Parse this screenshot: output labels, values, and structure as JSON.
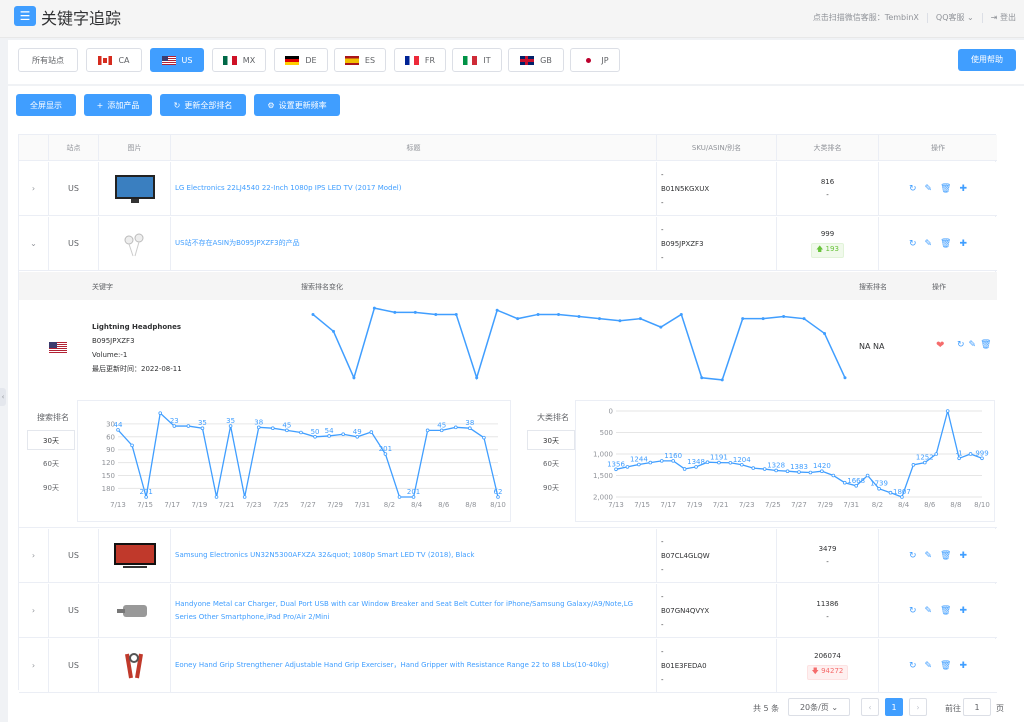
{
  "app": {
    "title": "关键字追踪",
    "scan_service": "点击扫描微信客服：TembinX",
    "qq_service": "QQ客服",
    "logout": "登出"
  },
  "sites": [
    {
      "label": "所有站点",
      "flag": ""
    },
    {
      "label": "CA",
      "flag": "ca"
    },
    {
      "label": "US",
      "flag": "us"
    },
    {
      "label": "MX",
      "flag": "mx"
    },
    {
      "label": "DE",
      "flag": "de"
    },
    {
      "label": "ES",
      "flag": "es"
    },
    {
      "label": "FR",
      "flag": "fr"
    },
    {
      "label": "IT",
      "flag": "it"
    },
    {
      "label": "GB",
      "flag": "gb"
    },
    {
      "label": "JP",
      "flag": "jp"
    }
  ],
  "help_label": "使用帮助",
  "toolbar": {
    "fullscreen": "全屏显示",
    "add_product": "添加产品",
    "update_all": "更新全部排名",
    "set_frequency": "设置更新频率"
  },
  "table": {
    "headers": {
      "site": "站点",
      "image": "图片",
      "title": "标题",
      "sku": "SKU/ASIN/别名",
      "rank": "大类排名",
      "ops": "操作"
    },
    "rows": [
      {
        "site": "US",
        "title": "LG Electronics 22LJ4540 22-Inch 1080p IPS LED TV (2017 Model)",
        "sku_top": "-",
        "asin": "B01N5KGXUX",
        "sku_bottom": "-",
        "rank": "816",
        "change": "-",
        "change_type": "none"
      },
      {
        "site": "US",
        "title": "US站不存在ASIN为B095JPXZF3的产品",
        "sku_top": "-",
        "asin": "B095JPXZF3",
        "sku_bottom": "-",
        "rank": "999",
        "change": "193",
        "change_type": "up"
      },
      {
        "site": "US",
        "title": "Samsung Electronics UN32N5300AFXZA 32&quot; 1080p Smart LED TV (2018), Black",
        "sku_top": "-",
        "asin": "B07CL4GLQW",
        "sku_bottom": "-",
        "rank": "3479",
        "change": "-",
        "change_type": "none"
      },
      {
        "site": "US",
        "title": "Handyone Metal car Charger, Dual Port USB with car Window Breaker and Seat Belt Cutter for iPhone/Samsung Galaxy/A9/Note,LG Series Other Smartphone,iPad Pro/Air 2/Mini",
        "sku_top": "-",
        "asin": "B07GN4QVYX",
        "sku_bottom": "-",
        "rank": "11386",
        "change": "-",
        "change_type": "none"
      },
      {
        "site": "US",
        "title": "Eoney Hand Grip Strengthener Adjustable Hand Grip Exerciser，Hand Gripper with Resistance Range 22 to 88 Lbs(10-40kg)",
        "sku_top": "-",
        "asin": "B01E3FEDA0",
        "sku_bottom": "-",
        "rank": "206074",
        "change": "94272",
        "change_type": "down"
      }
    ]
  },
  "keyword_panel": {
    "headers": {
      "keyword": "关键字",
      "trend": "搜索排名变化",
      "search_rank": "搜索排名",
      "ops": "操作"
    },
    "keyword": "Lightning Headphones",
    "asin": "B095JPXZF3",
    "volume": "Volume:-1",
    "updated": "最后更新时间：2022-08-11",
    "search_rank_value": "NA NA",
    "left_chart_label": "搜索排名",
    "right_chart_label": "大类排名",
    "ranges": [
      "30天",
      "60天",
      "90天"
    ]
  },
  "chart_data": [
    {
      "type": "line",
      "title": "搜索排名变化",
      "values": [
        20,
        60,
        170,
        5,
        15,
        15,
        20,
        20,
        170,
        10,
        30,
        20,
        20,
        25,
        30,
        35,
        30,
        50,
        20,
        170,
        175,
        30,
        30,
        25,
        30,
        65,
        170
      ]
    },
    {
      "type": "line",
      "title": "搜索排名",
      "x": [
        "7/13",
        "7/15",
        "7/17",
        "7/19",
        "7/21",
        "7/23",
        "7/25",
        "7/27",
        "7/29",
        "7/31",
        "8/2",
        "8/4",
        "8/6",
        "8/8",
        "8/10"
      ],
      "y_ticks": [
        "30",
        "60",
        "90",
        "120",
        "150",
        "180"
      ],
      "ylim": [
        0,
        200
      ],
      "values": [
        44,
        80,
        201,
        5,
        35,
        35,
        40,
        201,
        35,
        201,
        38,
        40,
        45,
        50,
        60,
        58,
        54,
        60,
        49,
        100,
        201,
        201,
        45,
        45,
        38,
        40,
        62,
        201
      ],
      "labels": [
        "44",
        "201",
        "23",
        "35",
        "35",
        "38",
        "45",
        "50",
        "54",
        "49",
        "201",
        "201",
        "45",
        "38",
        "62"
      ]
    },
    {
      "type": "line",
      "title": "大类排名",
      "x": [
        "7/13",
        "7/15",
        "7/17",
        "7/19",
        "7/21",
        "7/23",
        "7/25",
        "7/27",
        "7/29",
        "7/31",
        "8/2",
        "8/4",
        "8/6",
        "8/8",
        "8/10"
      ],
      "y_ticks": [
        "0",
        "500",
        "1,000",
        "1,500",
        "2,000"
      ],
      "ylim": [
        0,
        2000
      ],
      "values": [
        1356,
        1300,
        1244,
        1200,
        1160,
        1160,
        1348,
        1300,
        1191,
        1200,
        1204,
        1250,
        1328,
        1350,
        1383,
        1400,
        1420,
        1430,
        1400,
        1500,
        1668,
        1739,
        1500,
        1807,
        1900,
        2000,
        1252,
        1200,
        1000,
        -1,
        1100,
        999,
        1100
      ],
      "labels": [
        "1356",
        "1244",
        "1160",
        "1348",
        "1191",
        "1204",
        "1328",
        "1383",
        "1420",
        "1668",
        "1739",
        "1807",
        "1252",
        "-1",
        "999"
      ]
    }
  ],
  "pagination": {
    "total": "共 5 条",
    "page_size": "20条/页",
    "current": "1",
    "goto_label": "前往",
    "goto_value": "1",
    "page_suffix": "页"
  }
}
